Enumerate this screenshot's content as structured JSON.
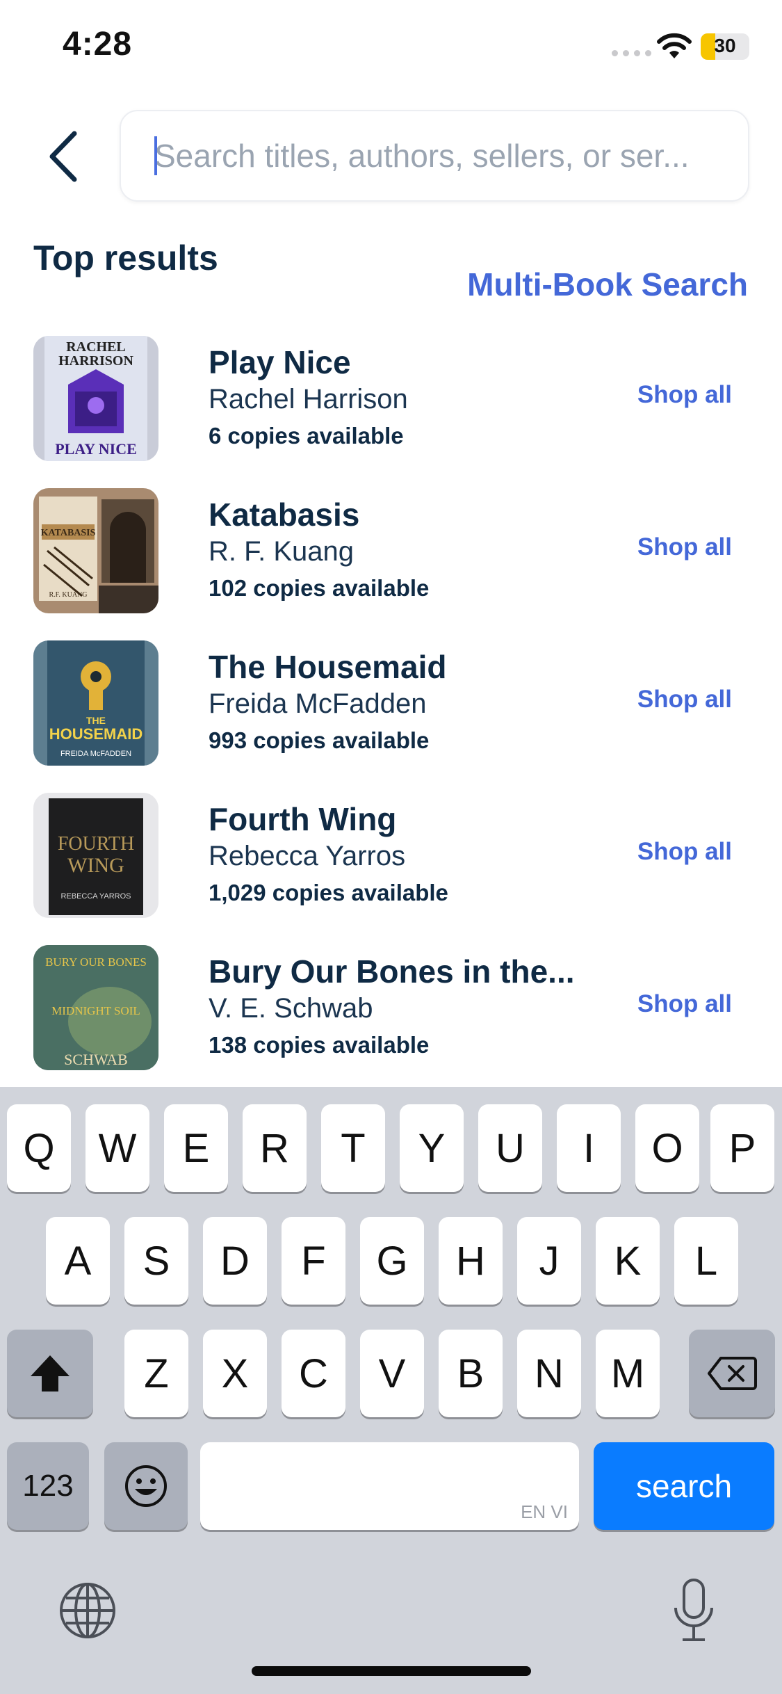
{
  "status_bar": {
    "time": "4:28",
    "battery_percent": "30",
    "battery_level": 0.3
  },
  "search": {
    "placeholder": "Search titles, authors, sellers, or ser...",
    "value": ""
  },
  "section_title": "Top results",
  "multi_book_search": "Multi-Book Search",
  "results": [
    {
      "title": "Play Nice",
      "author": "Rachel Harrison",
      "copies": "6 copies available",
      "shop_label": "Shop all",
      "cover": {
        "text_top": "RACHEL",
        "text_top2": "HARRISON",
        "text_bottom": "PLAY NICE"
      }
    },
    {
      "title": "Katabasis",
      "author": "R. F. Kuang",
      "copies": "102 copies available",
      "shop_label": "Shop all",
      "cover": {
        "text_top": "KATABASIS",
        "text_top2": "",
        "text_bottom": "R.F. KUANG"
      }
    },
    {
      "title": "The Housemaid",
      "author": "Freida McFadden",
      "copies": "993 copies available",
      "shop_label": "Shop all",
      "cover": {
        "text_top": "THE",
        "text_top2": "HOUSEMAID",
        "text_bottom": "FREIDA McFADDEN"
      }
    },
    {
      "title": "Fourth Wing",
      "author": "Rebecca Yarros",
      "copies": "1,029 copies available",
      "shop_label": "Shop all",
      "cover": {
        "text_top": "FOURTH",
        "text_top2": "WING",
        "text_bottom": "REBECCA YARROS"
      }
    },
    {
      "title": "Bury Our Bones in the...",
      "author": "V. E. Schwab",
      "copies": "138 copies available",
      "shop_label": "Shop all",
      "cover": {
        "text_top": "BURY OUR BONES",
        "text_top2": "MIDNIGHT SOIL",
        "text_bottom": "SCHWAB"
      }
    }
  ],
  "keyboard": {
    "row1": [
      "Q",
      "W",
      "E",
      "R",
      "T",
      "Y",
      "U",
      "I",
      "O",
      "P"
    ],
    "row2": [
      "A",
      "S",
      "D",
      "F",
      "G",
      "H",
      "J",
      "K",
      "L"
    ],
    "row3": [
      "Z",
      "X",
      "C",
      "V",
      "B",
      "N",
      "M"
    ],
    "numbers_label": "123",
    "search_label": "search",
    "lang_hint": "EN VI"
  },
  "colors": {
    "accent": "#4468d8",
    "text_dark": "#0f2a44",
    "key_blue": "#0a7cff"
  },
  "icons": {
    "back": "chevron-left-icon",
    "wifi": "wifi-icon",
    "shift": "shift-icon",
    "delete": "backspace-icon",
    "emoji": "emoji-icon",
    "globe": "globe-icon",
    "mic": "microphone-icon"
  }
}
